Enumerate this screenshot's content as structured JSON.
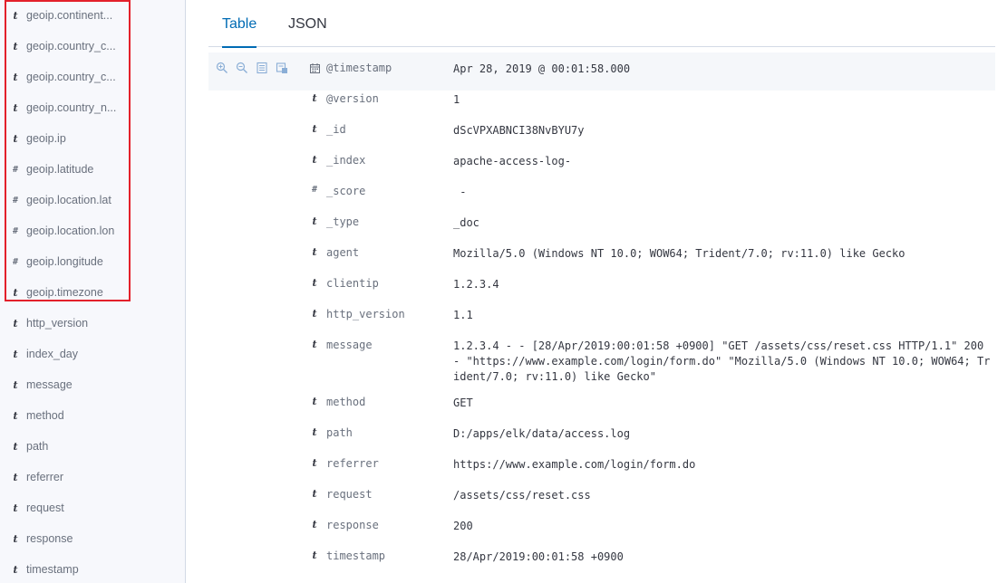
{
  "sidebar": {
    "fields": [
      {
        "type": "t",
        "name": "geoip.continent..."
      },
      {
        "type": "t",
        "name": "geoip.country_c..."
      },
      {
        "type": "t",
        "name": "geoip.country_c..."
      },
      {
        "type": "t",
        "name": "geoip.country_n..."
      },
      {
        "type": "t",
        "name": "geoip.ip"
      },
      {
        "type": "#",
        "name": "geoip.latitude"
      },
      {
        "type": "#",
        "name": "geoip.location.lat"
      },
      {
        "type": "#",
        "name": "geoip.location.lon"
      },
      {
        "type": "#",
        "name": "geoip.longitude"
      },
      {
        "type": "t",
        "name": "geoip.timezone"
      },
      {
        "type": "t",
        "name": "http_version"
      },
      {
        "type": "t",
        "name": "index_day"
      },
      {
        "type": "t",
        "name": "message"
      },
      {
        "type": "t",
        "name": "method"
      },
      {
        "type": "t",
        "name": "path"
      },
      {
        "type": "t",
        "name": "referrer"
      },
      {
        "type": "t",
        "name": "request"
      },
      {
        "type": "t",
        "name": "response"
      },
      {
        "type": "t",
        "name": "timestamp"
      }
    ],
    "highlight_color": "#e3202b"
  },
  "tabs": [
    {
      "label": "Table",
      "active": true
    },
    {
      "label": "JSON",
      "active": false
    }
  ],
  "document": {
    "row_actions": [
      "zoom-in-icon",
      "zoom-out-icon",
      "toggle-column-icon",
      "filter-exists-icon"
    ],
    "rows": [
      {
        "type": "date",
        "field": "@timestamp",
        "value": "Apr 28, 2019 @ 00:01:58.000"
      },
      {
        "type": "t",
        "field": "@version",
        "value": "1"
      },
      {
        "type": "t",
        "field": "_id",
        "value": "dScVPXABNCI38NvBYU7y"
      },
      {
        "type": "t",
        "field": "_index",
        "value": "apache-access-log-"
      },
      {
        "type": "#",
        "field": "_score",
        "value": " -"
      },
      {
        "type": "t",
        "field": "_type",
        "value": "_doc"
      },
      {
        "type": "t",
        "field": "agent",
        "value": "Mozilla/5.0 (Windows NT 10.0; WOW64; Trident/7.0; rv:11.0) like Gecko"
      },
      {
        "type": "t",
        "field": "clientip",
        "value": "1.2.3.4"
      },
      {
        "type": "t",
        "field": "http_version",
        "value": "1.1"
      },
      {
        "type": "t",
        "field": "message",
        "value": "1.2.3.4 - - [28/Apr/2019:00:01:58 +0900] \"GET /assets/css/reset.css HTTP/1.1\" 200 - \"https://www.example.com/login/form.do\" \"Mozilla/5.0 (Windows NT 10.0; WOW64; Trident/7.0; rv:11.0) like Gecko\""
      },
      {
        "type": "t",
        "field": "method",
        "value": "GET"
      },
      {
        "type": "t",
        "field": "path",
        "value": "D:/apps/elk/data/access.log"
      },
      {
        "type": "t",
        "field": "referrer",
        "value": "https://www.example.com/login/form.do"
      },
      {
        "type": "t",
        "field": "request",
        "value": "/assets/css/reset.css"
      },
      {
        "type": "t",
        "field": "response",
        "value": "200"
      },
      {
        "type": "t",
        "field": "timestamp",
        "value": "28/Apr/2019:00:01:58 +0900"
      }
    ]
  },
  "colors": {
    "accent": "#006bb4",
    "text": "#343741",
    "subdued": "#69707d",
    "border": "#d3dae6"
  }
}
